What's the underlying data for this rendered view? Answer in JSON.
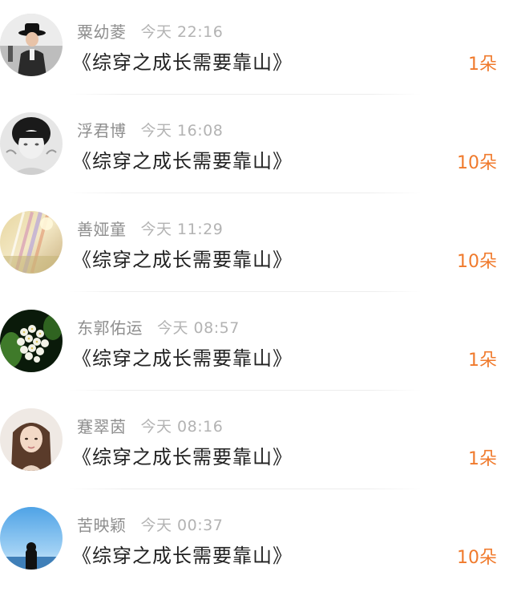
{
  "colors": {
    "accent": "#f07a2c",
    "name": "#8e8e8e",
    "time": "#b3b3b3",
    "title": "#222222"
  },
  "gifts": [
    {
      "avatar_icon": "avatar-man-black-hat-icon",
      "name": "粟幼菱",
      "time": "今天  22:16",
      "title": "《综穿之成长需要靠山》",
      "count": "1朵"
    },
    {
      "avatar_icon": "avatar-grayscale-portrait-icon",
      "name": "浮君博",
      "time": "今天  16:08",
      "title": "《综穿之成长需要靠山》",
      "count": "10朵"
    },
    {
      "avatar_icon": "avatar-sunlight-abstract-icon",
      "name": "善娅童",
      "time": "今天  11:29",
      "title": "《综穿之成长需要靠山》",
      "count": "10朵"
    },
    {
      "avatar_icon": "avatar-white-flowers-icon",
      "name": "东郭佑运",
      "time": "今天  08:57",
      "title": "《综穿之成长需要靠山》",
      "count": "1朵"
    },
    {
      "avatar_icon": "avatar-long-hair-girl-icon",
      "name": "蹇翠茵",
      "time": "今天  08:16",
      "title": "《综穿之成长需要靠山》",
      "count": "1朵"
    },
    {
      "avatar_icon": "avatar-sky-silhouette-icon",
      "name": "苦映颖",
      "time": "今天  00:37",
      "title": "《综穿之成长需要靠山》",
      "count": "10朵"
    }
  ]
}
